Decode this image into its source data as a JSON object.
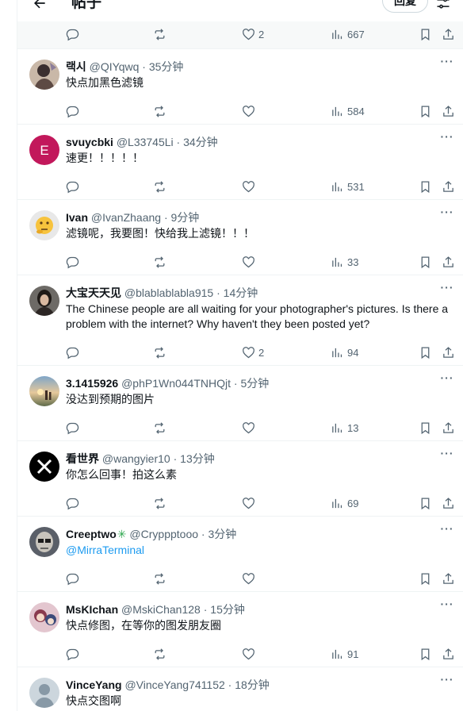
{
  "header": {
    "title": "帖子",
    "reply_button": "回复"
  },
  "top_row": {
    "likes": "2",
    "views": "667"
  },
  "replies": [
    {
      "name": "랙시",
      "handle": "@QIYqwq",
      "time": "35分钟",
      "text": "快点加黑色滤镜",
      "likes": "",
      "views": "584",
      "avatar": "photo-dark",
      "mention": false
    },
    {
      "name": "svuycbki",
      "handle": "@L33745Li",
      "time": "34分钟",
      "text": "速更！！！！！",
      "likes": "",
      "views": "531",
      "avatar": "letter-E",
      "mention": false
    },
    {
      "name": "Ivan",
      "handle": "@IvanZhaang",
      "time": "9分钟",
      "text": "滤镜呢，我要图！快给我上滤镜！！！",
      "likes": "",
      "views": "33",
      "avatar": "emoji-thinking",
      "mention": false
    },
    {
      "name": "大宝天天见",
      "handle": "@blablablabla915",
      "time": "14分钟",
      "text": "The Chinese people are all waiting for your photographer's pictures. Is there a problem with the internet? Why haven't they been posted yet?",
      "likes": "2",
      "views": "94",
      "avatar": "photo-portrait",
      "mention": false
    },
    {
      "name": "3.1415926",
      "handle": "@phP1Wn044TNHQjt",
      "time": "5分钟",
      "text": "没达到预期的图片",
      "likes": "",
      "views": "13",
      "avatar": "photo-sunset",
      "mention": false
    },
    {
      "name": "看世界",
      "handle": "@wangyier10",
      "time": "13分钟",
      "text": "你怎么回事！拍这么素",
      "likes": "",
      "views": "69",
      "avatar": "x-logo",
      "mention": false
    },
    {
      "name": "Creeptwo",
      "handle": "@Cryppptooo",
      "time": "3分钟",
      "text": "@MirraTerminal",
      "likes": "",
      "views": "",
      "avatar": "photo-face",
      "mention": true,
      "badge": "puzzle"
    },
    {
      "name": "MsKIchan",
      "handle": "@MskiChan128",
      "time": "15分钟",
      "text": "快点修图，在等你的图发朋友圈",
      "likes": "",
      "views": "91",
      "avatar": "photo-anime",
      "mention": false
    },
    {
      "name": "VinceYang",
      "handle": "@VinceYang741152",
      "time": "18分钟",
      "text": "快点交图啊",
      "likes": "",
      "views": "",
      "avatar": "default",
      "mention": false
    }
  ],
  "colors": {
    "accent": "#1d9bf0",
    "muted": "#536471",
    "border": "#eff3f4"
  }
}
